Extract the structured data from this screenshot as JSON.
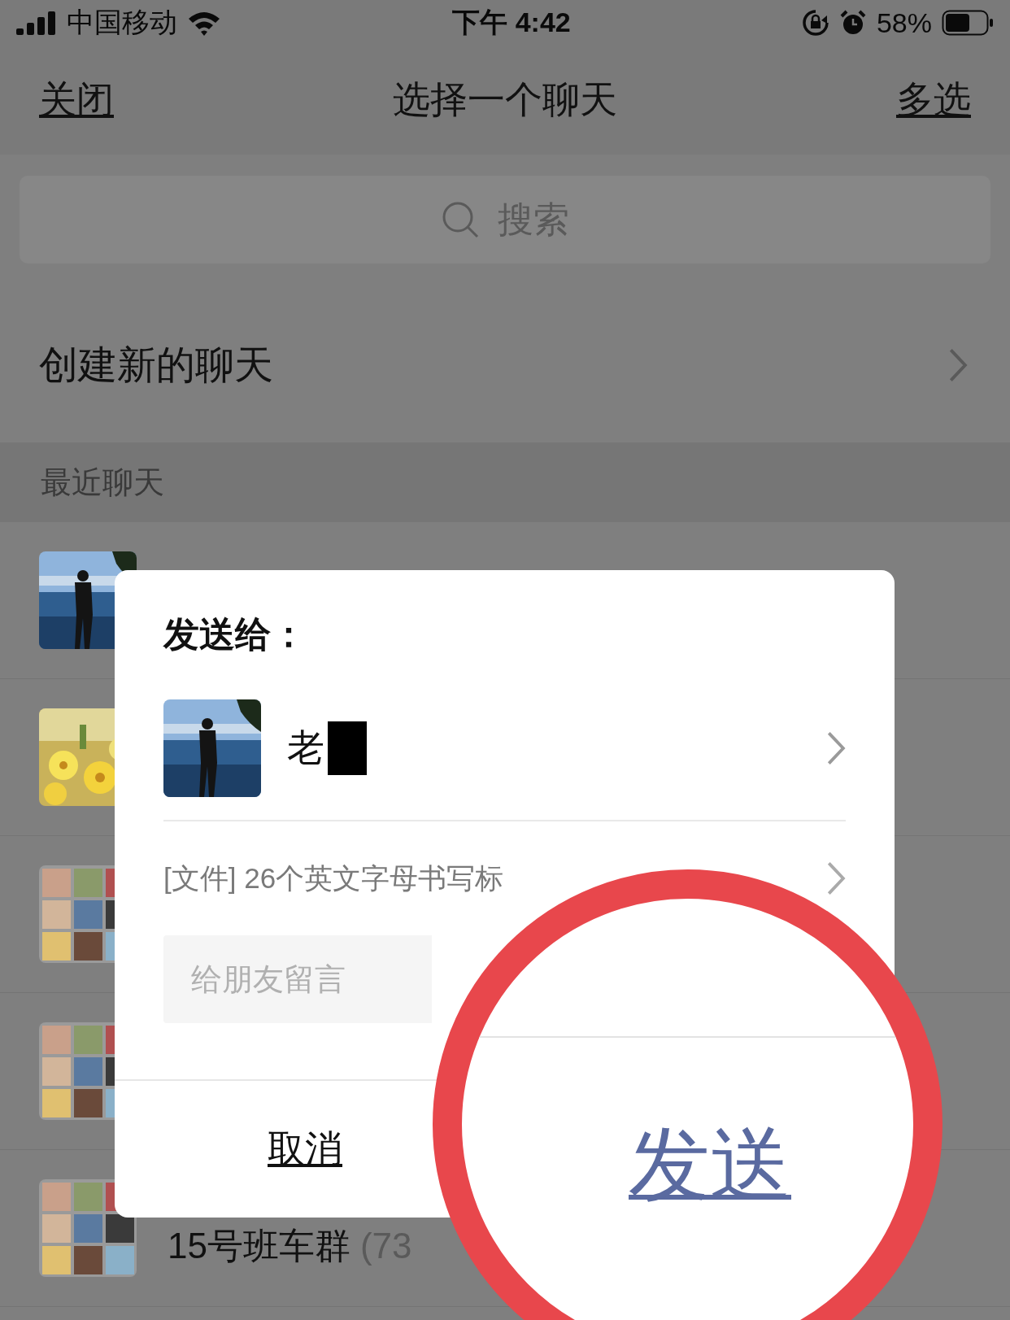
{
  "status_bar": {
    "carrier": "中国移动",
    "time": "下午 4:42",
    "battery": "58%"
  },
  "nav": {
    "close": "关闭",
    "title": "选择一个聊天",
    "multi_select": "多选"
  },
  "search": {
    "placeholder": "搜索"
  },
  "create_chat": {
    "label": "创建新的聊天"
  },
  "section_header": "最近聊天",
  "chats": [
    {
      "kind": "lake"
    },
    {
      "kind": "flowers"
    },
    {
      "kind": "group"
    },
    {
      "kind": "group"
    },
    {
      "kind": "group",
      "name": "15号班车群",
      "count": "(73"
    }
  ],
  "dialog": {
    "heading": "发送给：",
    "recipient": {
      "name": "老",
      "kind": "lake",
      "redacted": true
    },
    "attachment": {
      "label": "[文件] 26个英文字母书写标"
    },
    "message": {
      "placeholder": "给朋友留言"
    },
    "cancel": "取消"
  },
  "annotation": {
    "send": "发送"
  }
}
